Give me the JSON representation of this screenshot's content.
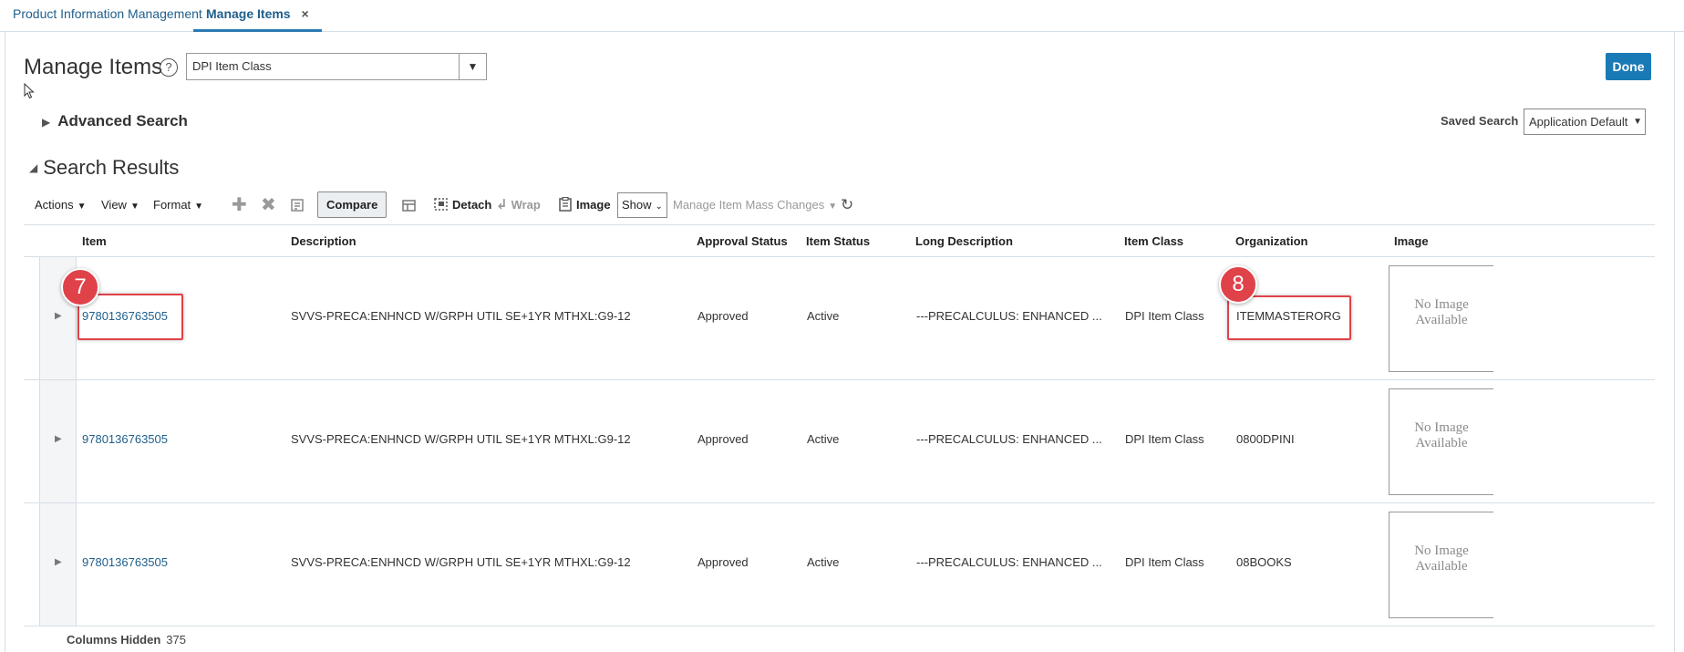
{
  "tabs": [
    {
      "label": "Product Information Management"
    },
    {
      "label": "Manage Items",
      "close": "×"
    }
  ],
  "header": {
    "title": "Manage Items",
    "help_glyph": "?",
    "item_class_value": "DPI Item Class",
    "done_label": "Done"
  },
  "advanced_search": {
    "label": "Advanced Search"
  },
  "saved_search": {
    "label": "Saved Search",
    "value": "Application Default"
  },
  "results": {
    "title": "Search Results"
  },
  "toolbar": {
    "actions": "Actions",
    "view": "View",
    "format": "Format",
    "compare": "Compare",
    "detach": "Detach",
    "wrap": "Wrap",
    "image": "Image",
    "show": "Show",
    "mass_changes": "Manage Item Mass Changes"
  },
  "columns": [
    "Item",
    "Description",
    "Approval Status",
    "Item Status",
    "Long Description",
    "Item Class",
    "Organization",
    "Image"
  ],
  "rows": [
    {
      "item": "9780136763505",
      "description": "SVVS-PRECA:ENHNCD W/GRPH UTIL SE+1YR MTHXL:G9-12",
      "approval": "Approved",
      "status": "Active",
      "long_description": "---PRECALCULUS: ENHANCED ...",
      "item_class": "DPI Item Class",
      "organization": "ITEMMASTERORG",
      "image": "No Image Available"
    },
    {
      "item": "9780136763505",
      "description": "SVVS-PRECA:ENHNCD W/GRPH UTIL SE+1YR MTHXL:G9-12",
      "approval": "Approved",
      "status": "Active",
      "long_description": "---PRECALCULUS: ENHANCED ...",
      "item_class": "DPI Item Class",
      "organization": "0800DPINI",
      "image": "No Image Available"
    },
    {
      "item": "9780136763505",
      "description": "SVVS-PRECA:ENHNCD W/GRPH UTIL SE+1YR MTHXL:G9-12",
      "approval": "Approved",
      "status": "Active",
      "long_description": "---PRECALCULUS: ENHANCED ...",
      "item_class": "DPI Item Class",
      "organization": "08BOOKS",
      "image": "No Image Available"
    }
  ],
  "callouts": [
    "7",
    "8"
  ],
  "footer": {
    "label": "Columns Hidden",
    "count": "375"
  },
  "colors": {
    "accent": "#1a7ab5",
    "link": "#1f5f8b",
    "callout": "#e0424a"
  }
}
